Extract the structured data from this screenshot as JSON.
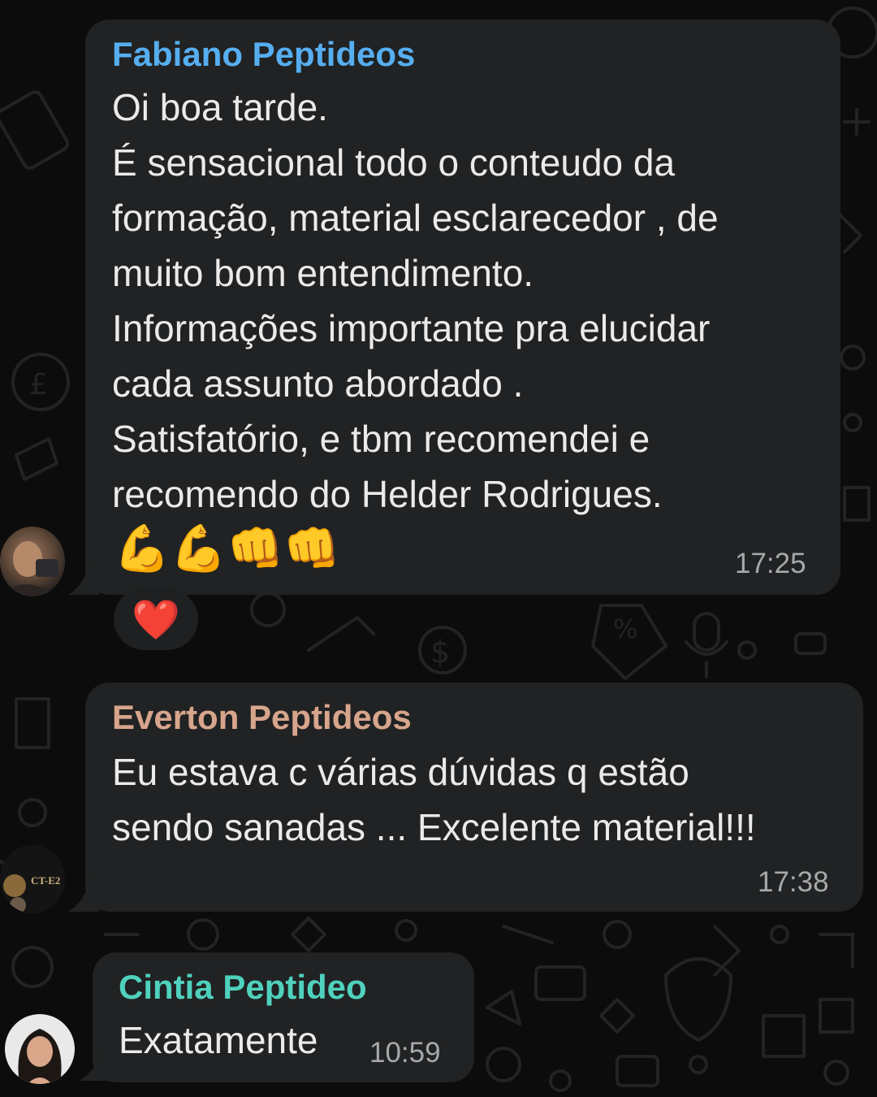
{
  "messages": [
    {
      "sender": "Fabiano Peptideos",
      "sender_color": "#56aef0",
      "lines": [
        "Oi boa tarde.",
        "É sensacional todo o conteudo da",
        "formação, material esclarecedor , de",
        "muito bom entendimento.",
        "Informações importante pra elucidar",
        "cada assunto abordado .",
        "Satisfatório, e tbm recomendei e",
        "recomendo do Helder Rodrigues."
      ],
      "emojis": "💪💪👊👊",
      "time": "17:25",
      "reaction": "❤️"
    },
    {
      "sender": "Everton Peptideos",
      "sender_color": "#d7a58c",
      "lines": [
        "Eu estava c várias dúvidas q estão",
        "sendo sanadas ... Excelente material!!!"
      ],
      "time": "17:38",
      "avatar_text": "CT-E2"
    },
    {
      "sender": "Cintia Peptideo",
      "sender_color": "#4fd1bd",
      "lines": [
        "Exatamente"
      ],
      "time": "10:59"
    }
  ]
}
